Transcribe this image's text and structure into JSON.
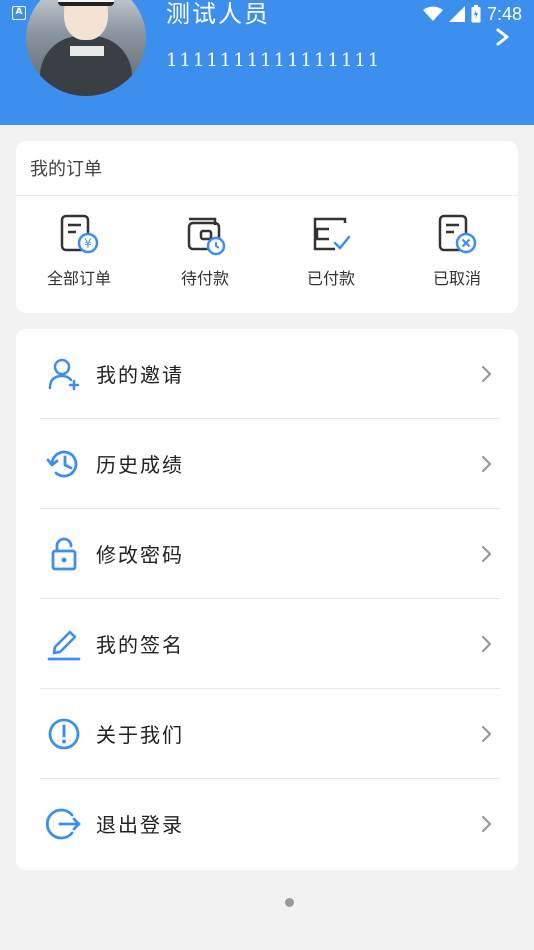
{
  "status_bar": {
    "time": "7:48",
    "app_icon_letter": "A"
  },
  "profile": {
    "name": "测试人员",
    "user_id": "1111111111111111"
  },
  "orders": {
    "title": "我的订单",
    "items": [
      {
        "label": "全部订单",
        "icon": "all-orders-icon"
      },
      {
        "label": "待付款",
        "icon": "wallet-pending-icon"
      },
      {
        "label": "已付款",
        "icon": "wallet-paid-icon"
      },
      {
        "label": "已取消",
        "icon": "order-cancelled-icon"
      }
    ]
  },
  "menu": {
    "items": [
      {
        "label": "我的邀请",
        "icon": "add-user-icon"
      },
      {
        "label": "历史成绩",
        "icon": "history-icon"
      },
      {
        "label": "修改密码",
        "icon": "lock-icon"
      },
      {
        "label": "我的签名",
        "icon": "pen-icon"
      },
      {
        "label": "关于我们",
        "icon": "info-icon"
      },
      {
        "label": "退出登录",
        "icon": "logout-icon"
      }
    ]
  },
  "colors": {
    "header": "#3d8fee",
    "accent": "#3d8fee",
    "background": "#f2f2f2"
  }
}
